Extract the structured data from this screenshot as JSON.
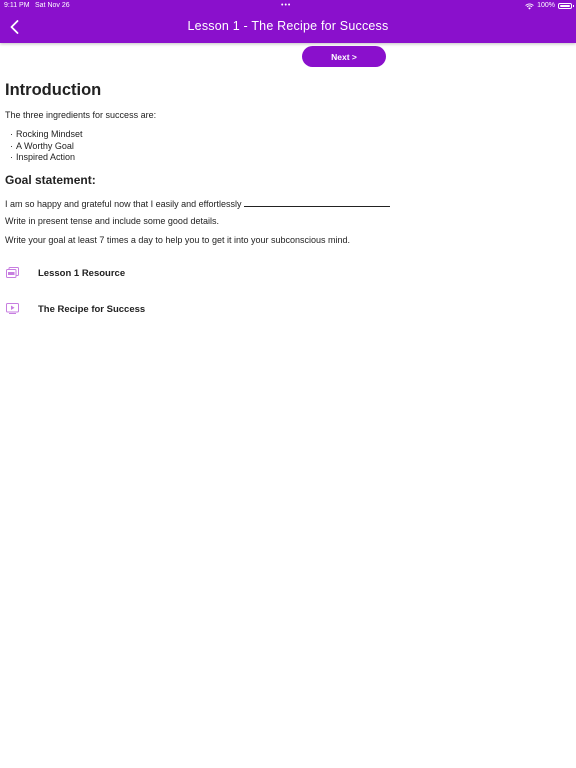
{
  "status_bar": {
    "time": "9:11 PM",
    "date": "Sat Nov 26",
    "dots": "•••",
    "battery": "100%"
  },
  "header": {
    "title": "Lesson 1 - The Recipe for Success",
    "back_icon": "chevron-left-icon",
    "background_color": "#8a10cc"
  },
  "next_button": {
    "label": "Next >"
  },
  "intro": {
    "heading": "Introduction",
    "text": "The three ingredients for success are:",
    "bullets": [
      "Rocking Mindset",
      "A Worthy Goal",
      "Inspired Action"
    ]
  },
  "goal": {
    "heading": "Goal statement:",
    "statement": "I am so happy and grateful now that I easily and effortlessly",
    "instruction_1": "Write in present tense and include some good details.",
    "instruction_2": "Write your goal at least 7 times a day to help you to get it into your subconscious mind."
  },
  "resources": [
    {
      "label": "Lesson 1 Resource",
      "icon": "pdf-icon"
    },
    {
      "label": "The Recipe for Success",
      "icon": "video-icon"
    }
  ],
  "accent_color": "#8a10cc",
  "icon_color": "#c77ee0"
}
